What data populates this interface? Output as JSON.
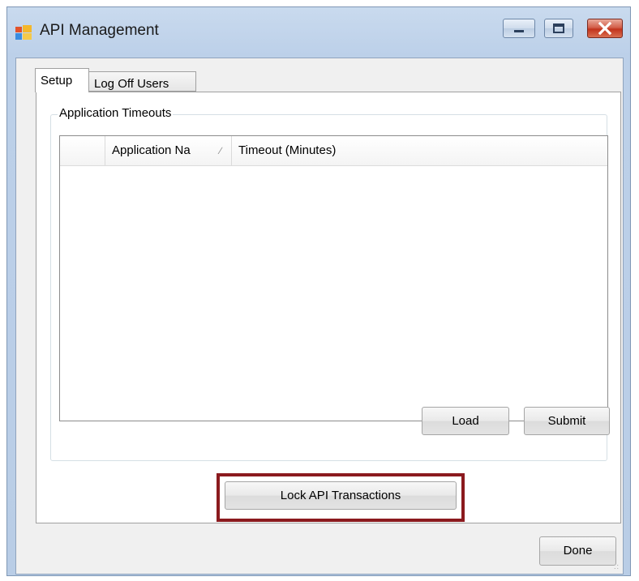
{
  "window": {
    "title": "API Management",
    "icon": "app-window-icon"
  },
  "tabs": [
    {
      "label": "Setup",
      "active": true
    },
    {
      "label": "Log Off Users",
      "active": false
    }
  ],
  "group": {
    "title": "Application Timeouts"
  },
  "grid": {
    "columns": [
      "",
      "Application Na",
      "Timeout (Minutes)"
    ],
    "sort_indicator": "∕",
    "rows": []
  },
  "buttons": {
    "load": "Load",
    "submit": "Submit",
    "lock": "Lock API Transactions",
    "done": "Done"
  },
  "colors": {
    "highlight_border": "#8b1a1e",
    "close_button": "#c2331c"
  }
}
